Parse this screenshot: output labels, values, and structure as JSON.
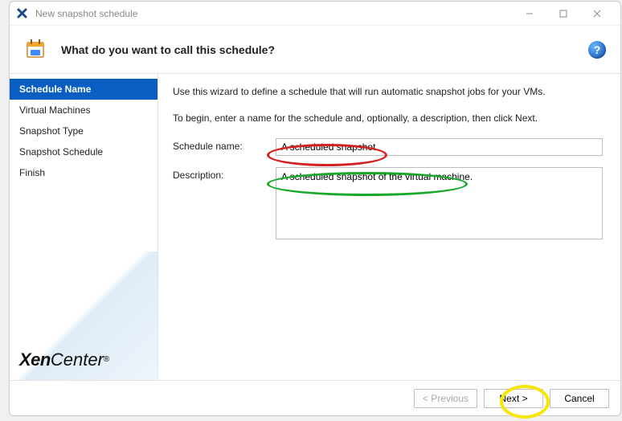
{
  "titlebar": {
    "title": "New snapshot schedule"
  },
  "header": {
    "title": "What do you want to call this schedule?"
  },
  "sidebar": {
    "steps": [
      {
        "label": "Schedule Name",
        "active": true
      },
      {
        "label": "Virtual Machines",
        "active": false
      },
      {
        "label": "Snapshot Type",
        "active": false
      },
      {
        "label": "Snapshot Schedule",
        "active": false
      },
      {
        "label": "Finish",
        "active": false
      }
    ]
  },
  "brand": {
    "part1": "Xen",
    "part2": "Center"
  },
  "main": {
    "instr1": "Use this wizard to define a schedule that will run automatic snapshot jobs for your VMs.",
    "instr2": "To begin, enter a name for the schedule and, optionally, a description, then click Next.",
    "name_label": "Schedule name:",
    "name_value": "A scheduled snapshot",
    "desc_label": "Description:",
    "desc_value": "A scheduled snapshot of the virtual machine."
  },
  "footer": {
    "previous": "< Previous",
    "next": "Next >",
    "cancel": "Cancel"
  }
}
